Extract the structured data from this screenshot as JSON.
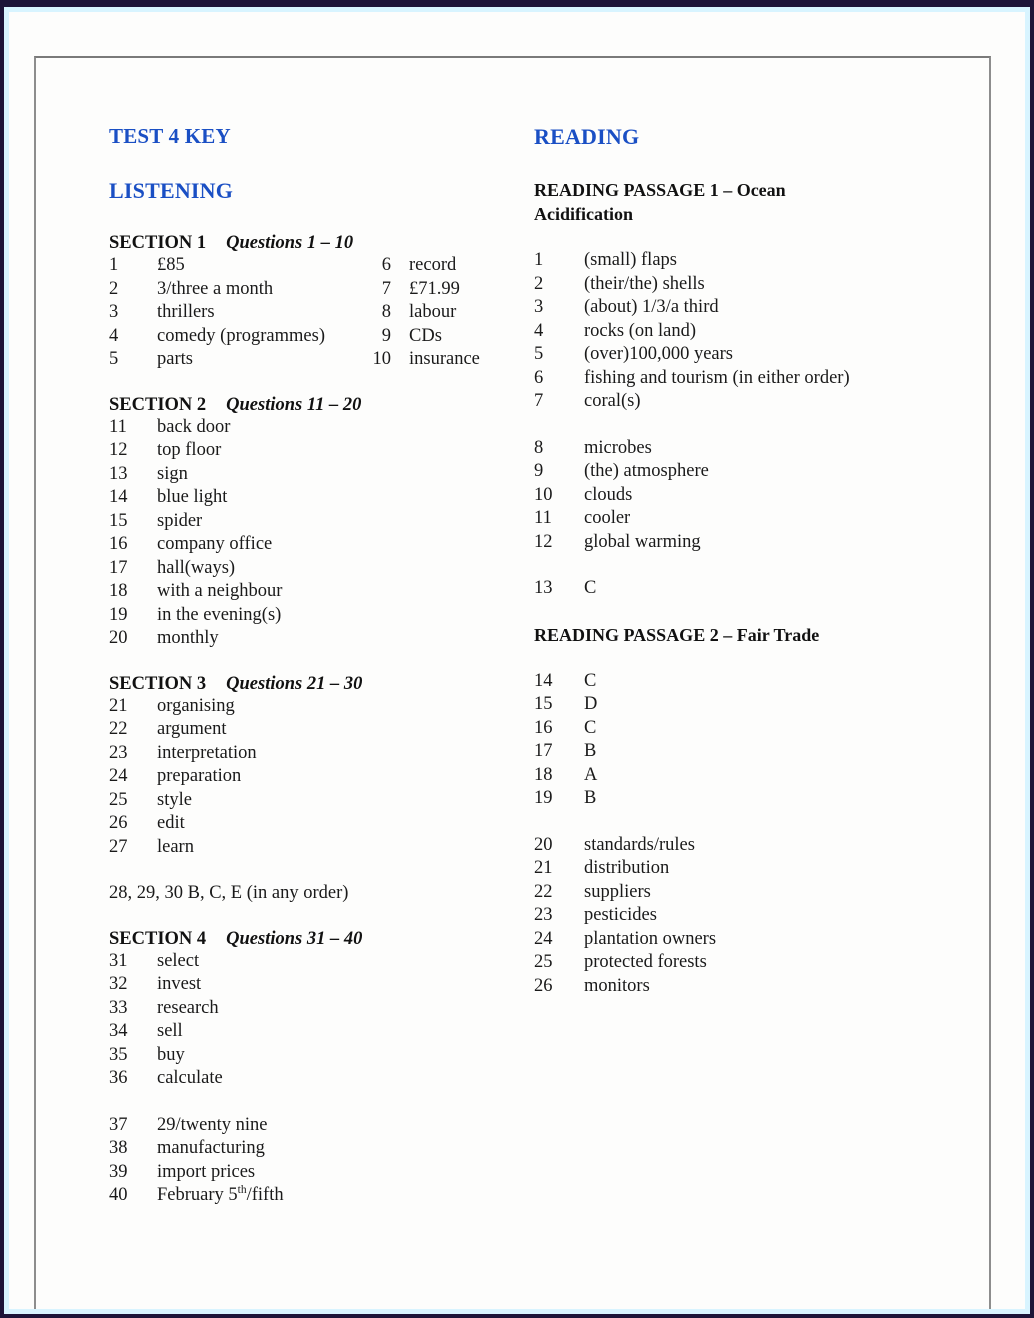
{
  "document": {
    "title": "TEST 4 KEY",
    "listening_title": "LISTENING",
    "reading_title": "READING"
  },
  "listening": {
    "sections": [
      {
        "name": "SECTION 1",
        "questions_range": "Questions 1 – 10",
        "answers_left": [
          {
            "num": "1",
            "answer": "£85"
          },
          {
            "num": "2",
            "answer": "3/three a month"
          },
          {
            "num": "3",
            "answer": "thrillers"
          },
          {
            "num": "4",
            "answer": "comedy (programmes)"
          },
          {
            "num": "5",
            "answer": "parts"
          }
        ],
        "answers_right": [
          {
            "num": "6",
            "answer": "record"
          },
          {
            "num": "7",
            "answer": "£71.99"
          },
          {
            "num": "8",
            "answer": "labour"
          },
          {
            "num": "9",
            "answer": "CDs"
          },
          {
            "num": "10",
            "answer": "insurance"
          }
        ]
      },
      {
        "name": "SECTION 2",
        "questions_range": "Questions 11 – 20",
        "answers_left": [
          {
            "num": "11",
            "answer": "back door"
          },
          {
            "num": "12",
            "answer": "top floor"
          },
          {
            "num": "13",
            "answer": "sign"
          },
          {
            "num": "14",
            "answer": "blue light"
          },
          {
            "num": "15",
            "answer": "spider"
          },
          {
            "num": "16",
            "answer": "company office"
          },
          {
            "num": "17",
            "answer": "hall(ways)"
          },
          {
            "num": "18",
            "answer": "with a neighbour"
          },
          {
            "num": "19",
            "answer": "in the evening(s)"
          },
          {
            "num": "20",
            "answer": "monthly"
          }
        ]
      },
      {
        "name": "SECTION 3",
        "questions_range": "Questions 21 – 30",
        "answers_left": [
          {
            "num": "21",
            "answer": "organising"
          },
          {
            "num": "22",
            "answer": "argument"
          },
          {
            "num": "23",
            "answer": "interpretation"
          },
          {
            "num": "24",
            "answer": "preparation"
          },
          {
            "num": "25",
            "answer": "style"
          },
          {
            "num": "26",
            "answer": "edit"
          },
          {
            "num": "27",
            "answer": "learn"
          }
        ],
        "note": "28, 29, 30 B, C, E (in any order)"
      },
      {
        "name": "SECTION 4",
        "questions_range": "Questions 31 – 40",
        "answers_left": [
          {
            "num": "31",
            "answer": "select"
          },
          {
            "num": "32",
            "answer": "invest"
          },
          {
            "num": "33",
            "answer": "research"
          },
          {
            "num": "34",
            "answer": "sell"
          },
          {
            "num": "35",
            "answer": "buy"
          },
          {
            "num": "36",
            "answer": "calculate"
          }
        ],
        "answers_left_b": [
          {
            "num": "37",
            "answer": "29/twenty nine"
          },
          {
            "num": "38",
            "answer": "manufacturing"
          },
          {
            "num": "39",
            "answer": "import prices"
          }
        ],
        "answer_40": {
          "num": "40",
          "prefix": "February 5",
          "sup": "th",
          "suffix": "/fifth"
        }
      }
    ]
  },
  "reading": {
    "passages": [
      {
        "heading": "READING PASSAGE 1 – Ocean Acidification",
        "answers_a": [
          {
            "num": "1",
            "answer": "(small) flaps"
          },
          {
            "num": "2",
            "answer": "(their/the) shells"
          },
          {
            "num": "3",
            "answer": "(about) 1/3/a third"
          },
          {
            "num": "4",
            "answer": "rocks (on land)"
          },
          {
            "num": "5",
            "answer": "(over)100,000 years"
          },
          {
            "num": "6",
            "answer": "fishing and tourism (in either order)"
          },
          {
            "num": "7",
            "answer": "coral(s)"
          }
        ],
        "answers_b": [
          {
            "num": "8",
            "answer": "microbes"
          },
          {
            "num": "9",
            "answer": "(the) atmosphere"
          },
          {
            "num": "10",
            "answer": "clouds"
          },
          {
            "num": "11",
            "answer": "cooler"
          },
          {
            "num": "12",
            "answer": "global warming"
          }
        ],
        "answers_c": [
          {
            "num": "13",
            "answer": "C"
          }
        ]
      },
      {
        "heading": "READING PASSAGE 2 – Fair Trade",
        "answers_a": [
          {
            "num": "14",
            "answer": "C"
          },
          {
            "num": "15",
            "answer": "D"
          },
          {
            "num": "16",
            "answer": "C"
          },
          {
            "num": "17",
            "answer": "B"
          },
          {
            "num": "18",
            "answer": "A"
          },
          {
            "num": "19",
            "answer": "B"
          }
        ],
        "answers_b": [
          {
            "num": "20",
            "answer": "standards/rules"
          },
          {
            "num": "21",
            "answer": "distribution"
          },
          {
            "num": "22",
            "answer": "suppliers"
          },
          {
            "num": "23",
            "answer": "pesticides"
          },
          {
            "num": "24",
            "answer": "plantation owners"
          },
          {
            "num": "25",
            "answer": "protected forests"
          },
          {
            "num": "26",
            "answer": "monitors"
          }
        ]
      }
    ]
  },
  "colors": {
    "heading_blue": "#1a4fc4",
    "frame_navy": "#1d1438",
    "frame_cyan": "#d8f4ff",
    "rule_gray": "#8d8d8d",
    "body_text": "#1a1a1a"
  }
}
